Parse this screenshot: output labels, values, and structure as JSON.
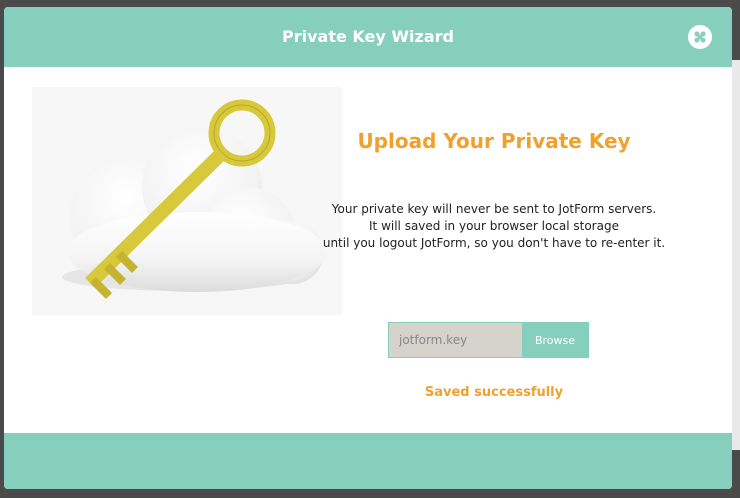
{
  "dialog": {
    "title": "Private Key Wizard",
    "close_icon": "close-x-circle-icon"
  },
  "main": {
    "heading": "Upload Your Private Key",
    "description_lines": [
      "Your private key will never be sent to JotForm servers.",
      "It will saved in your browser local storage",
      "until you logout JotForm, so you don't have to re-enter it."
    ],
    "file_input_value": "jotform.key",
    "browse_label": "Browse",
    "status_message": "Saved successfully"
  },
  "illustration": {
    "icons": [
      "cloud-icon",
      "key-icon"
    ]
  },
  "colors": {
    "accent": "#86cfbd",
    "heading": "#f0a02c",
    "key": "#d8c93a",
    "input_bg": "#d6d2cc"
  }
}
